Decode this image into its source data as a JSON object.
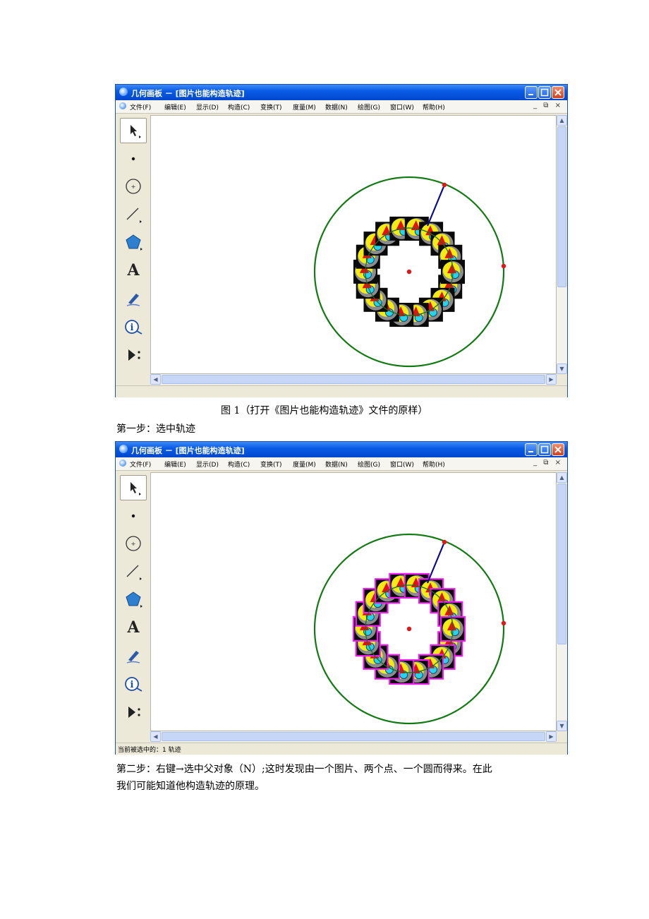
{
  "window": {
    "title": "几何画板 － [图片也能构造轨迹]",
    "menu": [
      "文件(F)",
      "编辑(E)",
      "显示(D)",
      "构造(C)",
      "变换(T)",
      "度量(M)",
      "数据(N)",
      "绘图(G)",
      "窗口(W)",
      "帮助(H)"
    ],
    "mdi_controls": "_ ⧉ ×"
  },
  "toolbox": [
    {
      "name": "arrow-select-tool",
      "label": ""
    },
    {
      "name": "point-tool",
      "label": ""
    },
    {
      "name": "compass-tool",
      "label": ""
    },
    {
      "name": "straightedge-tool",
      "label": ""
    },
    {
      "name": "polygon-tool",
      "label": ""
    },
    {
      "name": "text-tool",
      "label": "A"
    },
    {
      "name": "marker-tool",
      "label": ""
    },
    {
      "name": "information-tool",
      "label": ""
    },
    {
      "name": "custom-tool",
      "label": ""
    }
  ],
  "figure1": {
    "caption": "图 1（打开《图片也能构造轨迹》文件的原样）",
    "status": ""
  },
  "step1": "第一步：选中轨迹",
  "figure2": {
    "status": "当前被选中的：1 轨迹"
  },
  "step2": {
    "line1": "第二步：右键→选中父对象（N）;这时发现由一个图片、两个点、一个圆而得来。在此",
    "line2": "我们可能知道他构造轨迹的原理。"
  },
  "colors": {
    "circle": "#127a12",
    "point": "#e01818",
    "segment": "#0b0b8a",
    "selection": "#ee22ee",
    "titlebar": "#0a5ce6"
  }
}
